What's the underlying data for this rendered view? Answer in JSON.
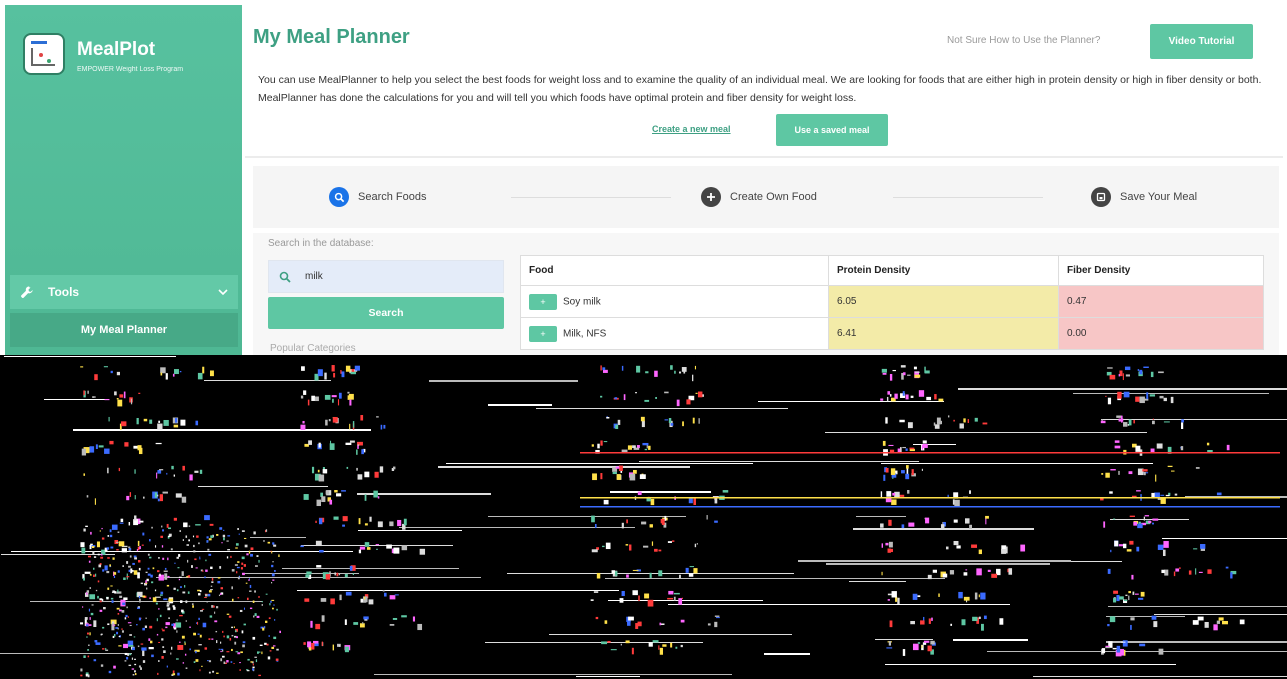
{
  "app": {
    "name": "MealPlot",
    "subtitle": "EMPOWER Weight Loss Program"
  },
  "sidebar": {
    "section_label": "Tools",
    "active_item": "My Meal Planner"
  },
  "header": {
    "title": "My Meal Planner",
    "help_text": "Not Sure How to Use the Planner?",
    "video_button": "Video Tutorial"
  },
  "description": "You can use MealPlanner to help you select the best foods for weight loss and to examine the quality of an individual meal. We are looking for foods that are either high in protein density or high in fiber density or both. MealPlanner has done the calculations for you and will tell you which foods have optimal protein and fiber density for weight loss.",
  "actions": {
    "create_link": "Create a new meal",
    "saved_button": "Use a saved meal"
  },
  "steps": [
    {
      "label": "Search Foods",
      "icon": "search-icon",
      "color": "#1a73e8"
    },
    {
      "label": "Create Own Food",
      "icon": "plus-icon",
      "color": "#444444"
    },
    {
      "label": "Save Your Meal",
      "icon": "save-icon",
      "color": "#444444"
    }
  ],
  "search": {
    "label": "Search in the database:",
    "value": "milk",
    "button": "Search",
    "popular_label": "Popular Categories"
  },
  "table": {
    "headers": [
      "Food",
      "Protein Density",
      "Fiber Density"
    ],
    "rows": [
      {
        "add": "+",
        "food": "Soy milk",
        "protein": "6.05",
        "fiber": "0.47"
      },
      {
        "add": "+",
        "food": "Milk, NFS",
        "protein": "6.41",
        "fiber": "0.00"
      }
    ]
  },
  "colors": {
    "brand": "#57c19f",
    "accent": "#5ec7a3",
    "protein_cell": "#f3eba8",
    "fiber_cell": "#f7c6c6"
  }
}
